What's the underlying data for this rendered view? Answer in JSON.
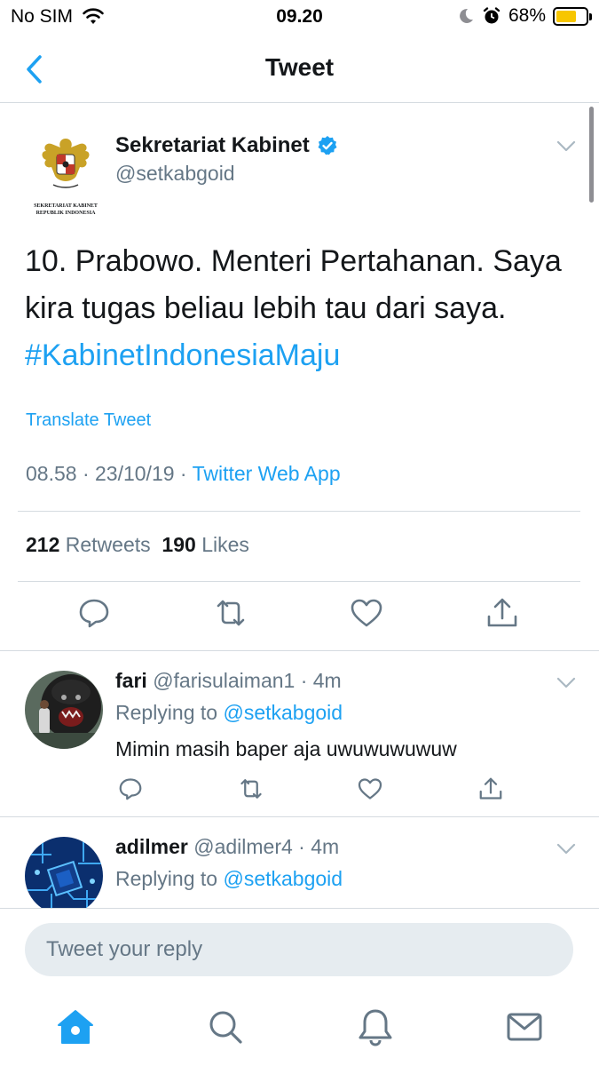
{
  "status_bar": {
    "carrier": "No SIM",
    "time": "09.20",
    "battery": "68%",
    "battery_level": 0.68
  },
  "nav": {
    "title": "Tweet"
  },
  "tweet": {
    "author_name": "Sekretariat Kabinet",
    "handle": "@setkabgoid",
    "logo_line1": "SEKRETARIAT KABINET",
    "logo_line2": "REPUBLIK INDONESIA",
    "text_line1": "10. Prabowo. Menteri Pertahanan. Saya",
    "text_line2": "kira tugas beliau lebih tau dari saya.",
    "hashtag": "#KabinetIndonesiaMaju",
    "translate": "Translate Tweet",
    "timestamp": "08.58 · 23/10/19 · ",
    "source": "Twitter Web App",
    "retweets_count": "212",
    "retweets_label": "Retweets",
    "likes_count": "190",
    "likes_label": "Likes"
  },
  "replies": [
    {
      "name": "fari",
      "handle": "@farisulaiman1",
      "time": " · 4m",
      "replying_prefix": "Replying to ",
      "mention": "@setkabgoid",
      "text": "Mimin masih baper aja uwuwuwuwuw"
    },
    {
      "name": "adilmer",
      "handle": "@adilmer4",
      "time": " · 4m",
      "replying_prefix": "Replying to ",
      "mention": "@setkabgoid"
    }
  ],
  "reply_box": {
    "placeholder": "Tweet your reply"
  },
  "colors": {
    "accent": "#1da1f2",
    "secondary_text": "#657786",
    "divider": "#d5dbe0"
  },
  "icons": [
    "back-chevron-icon",
    "verified-badge-icon",
    "reply-icon",
    "retweet-icon",
    "like-icon",
    "share-icon",
    "home-icon",
    "search-icon",
    "notifications-icon",
    "messages-icon"
  ]
}
